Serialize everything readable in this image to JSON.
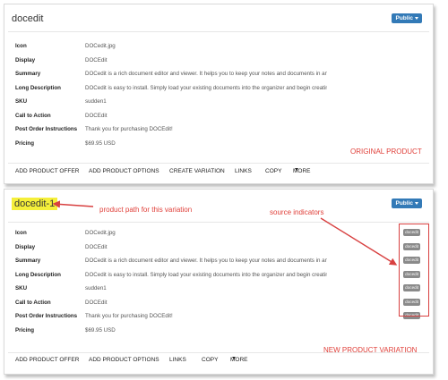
{
  "field_labels": [
    "Icon",
    "Display",
    "Summary",
    "Long Description",
    "SKU",
    "Call to Action",
    "Post Order Instructions",
    "Pricing"
  ],
  "original": {
    "title": "docedit",
    "badge": "Public",
    "values": [
      "DOCedit.jpg",
      "DOCEdit",
      "DOCedit is a rich document editor and viewer. It helps you to keep your notes and documents in an or...",
      "DOCedit is easy to install. Simply load your existing documents into the organizer and begin creatin...",
      "sudden1",
      "DOCEdit",
      "Thank you for purchasing DOCEdit!",
      "$69.95 USD"
    ],
    "actions": [
      "ADD PRODUCT OFFER",
      "ADD PRODUCT OPTIONS",
      "CREATE VARIATION",
      "LINKS",
      "COPY",
      "MORE"
    ]
  },
  "variation": {
    "title": "docedit-1",
    "badge": "Public",
    "values": [
      "DOCedit.jpg",
      "DOCEdit",
      "DOCedit is a rich document editor and viewer. It helps you to keep your notes and documents in an or...",
      "DOCedit is easy to install. Simply load your existing documents into the organizer and begin creatin...",
      "sudden1",
      "DOCEdit",
      "Thank you for purchasing DOCEdit!",
      "$69.95 USD"
    ],
    "source_indicator": "docedit",
    "actions": [
      "ADD PRODUCT OFFER",
      "ADD PRODUCT OPTIONS",
      "LINKS",
      "COPY",
      "MORE"
    ]
  },
  "annotations": {
    "original_label": "ORIGINAL PRODUCT",
    "variation_label": "NEW PRODUCT VARIATION",
    "path_label": "product path for this variation",
    "source_label": "source indicators",
    "color": "#e0403a"
  }
}
